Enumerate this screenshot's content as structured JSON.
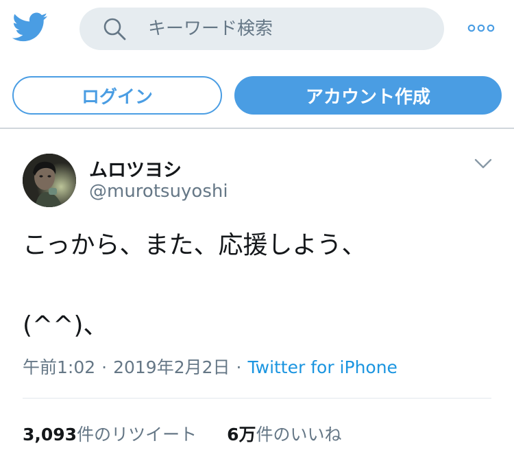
{
  "header": {
    "search": {
      "placeholder": "キーワード検索",
      "value": ""
    },
    "login_label": "ログイン",
    "signup_label": "アカウント作成"
  },
  "tweet": {
    "display_name": "ムロツヨシ",
    "handle": "@murotsuyoshi",
    "text_line1": "こっから、また、応援しよう、",
    "text_line2": "(^^)、",
    "time": "午前1:02",
    "date": "2019年2月2日",
    "separator": "·",
    "source": "Twitter for iPhone",
    "retweets": {
      "count": "3,093",
      "unit": "件",
      "label": "のリツイート"
    },
    "likes": {
      "count": "6万",
      "unit": "件",
      "label": "のいいね"
    }
  },
  "colors": {
    "accent": "#4a9de3",
    "link": "#1b95e0",
    "text_primary": "#14171a",
    "text_secondary": "#657786",
    "search_bg": "#e6ecf0"
  },
  "icons": {
    "logo": "twitter-bird-icon",
    "search": "search-icon",
    "more": "more-options-icon",
    "caret": "chevron-down-icon"
  }
}
